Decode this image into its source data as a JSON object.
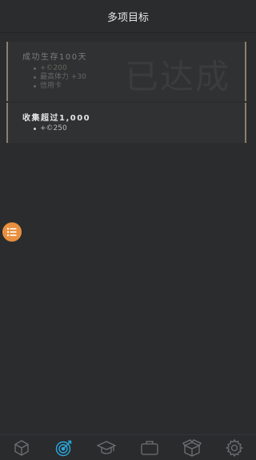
{
  "header": {
    "title": "多项目标"
  },
  "goals": [
    {
      "title": "成功生存100天",
      "status": "已达成",
      "rewards": [
        "+©200",
        "最高体力 +30",
        "信用卡"
      ]
    },
    {
      "title": "收集超过1,000",
      "rewards": [
        "+©250"
      ]
    }
  ],
  "tabs": [
    {
      "icon": "cube-icon"
    },
    {
      "icon": "target-icon"
    },
    {
      "icon": "graduation-cap-icon"
    },
    {
      "icon": "briefcase-icon"
    },
    {
      "icon": "box-icon"
    },
    {
      "icon": "gear-icon"
    }
  ],
  "colors": {
    "accent": "#e98f3e",
    "active_tab": "#29a8e0",
    "card_border": "#8b7f6e"
  }
}
